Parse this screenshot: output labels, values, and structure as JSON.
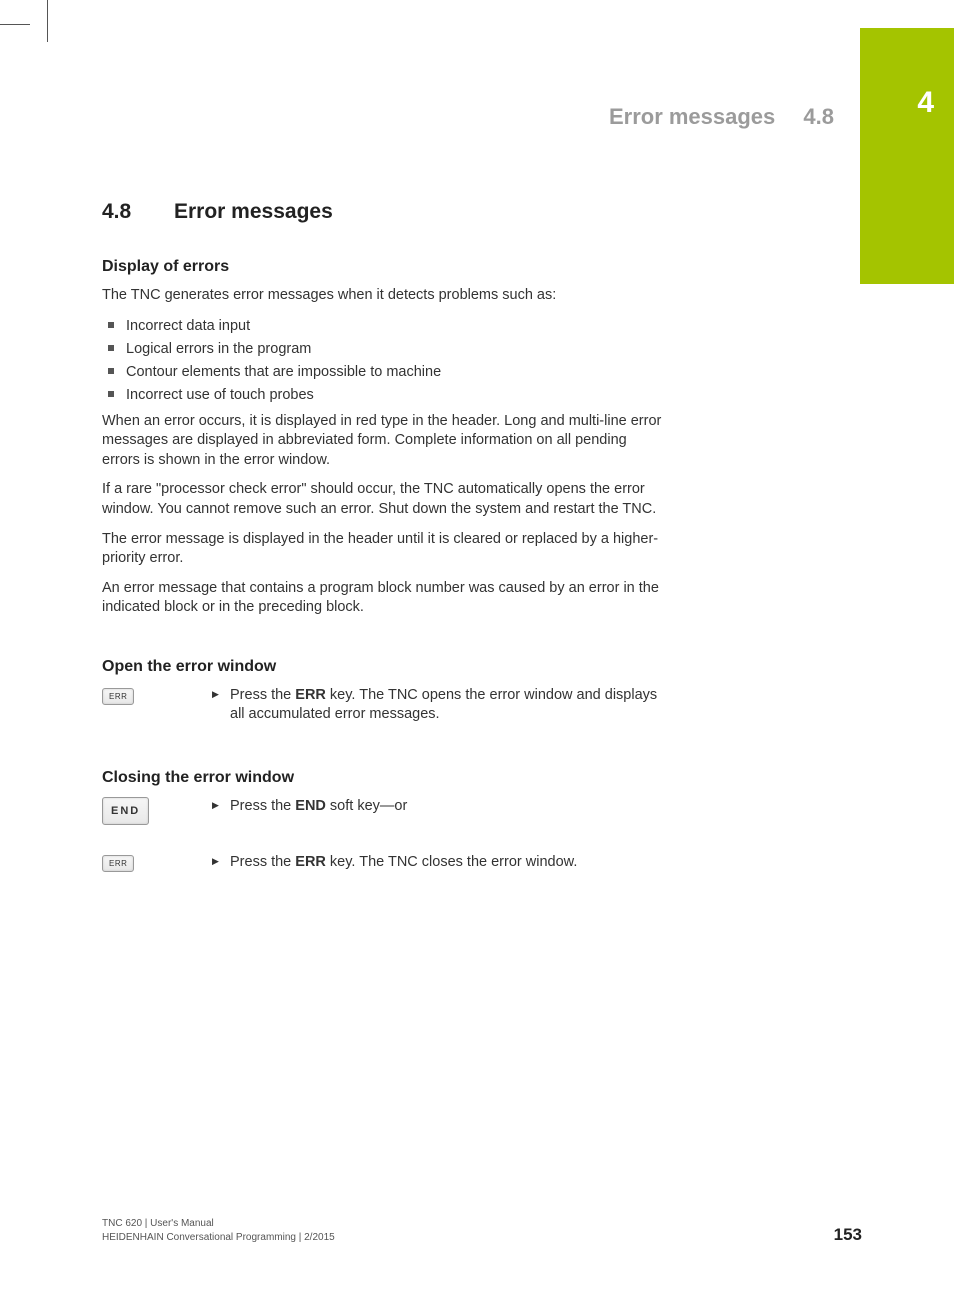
{
  "chapter": "4",
  "breadcrumb": {
    "title": "Error messages",
    "section": "4.8"
  },
  "heading": {
    "num": "4.8",
    "title": "Error messages"
  },
  "sub1": {
    "title": "Display of errors",
    "p1": "The TNC generates error messages when it detects problems such as:",
    "bullets": [
      "Incorrect data input",
      "Logical errors in the program",
      "Contour elements that are impossible to machine",
      "Incorrect use of touch probes"
    ],
    "p2": "When an error occurs, it is displayed in red type in the header. Long and multi-line error messages are displayed in abbreviated form. Complete information on all pending errors is shown in the error window.",
    "p3": "If a rare \"processor check error\" should occur, the TNC automatically opens the error window. You cannot remove such an error. Shut down the system and restart the TNC.",
    "p4": "The error message is displayed in the header until it is cleared or replaced by a higher-priority error.",
    "p5": "An error message that contains a program block number was caused by an error in the indicated block or in the preceding block."
  },
  "sub2": {
    "title": "Open the error window",
    "key1_label": "ERR",
    "item1_pre": "Press the ",
    "item1_bold": "ERR",
    "item1_post": " key. The TNC opens the error window and displays all accumulated error messages."
  },
  "sub3": {
    "title": "Closing the error window",
    "key1_label": "END",
    "item1_pre": "Press the ",
    "item1_bold": "END",
    "item1_post": " soft key—or",
    "key2_label": "ERR",
    "item2_pre": "Press the ",
    "item2_bold": "ERR",
    "item2_post": " key. The TNC closes the error window."
  },
  "footer": {
    "line1": "TNC 620 | User's Manual",
    "line2": "HEIDENHAIN Conversational Programming | 2/2015",
    "page": "153"
  }
}
